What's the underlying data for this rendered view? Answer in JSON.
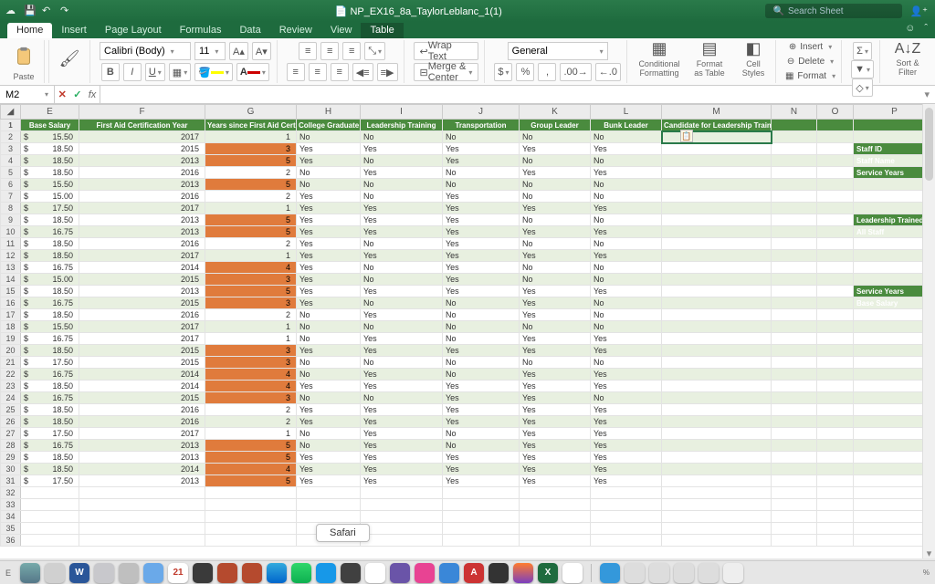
{
  "title": "NP_EX16_8a_TaylorLeblanc_1(1)",
  "search_placeholder": "Search Sheet",
  "tabs": [
    "Home",
    "Insert",
    "Page Layout",
    "Formulas",
    "Data",
    "Review",
    "View",
    "Table"
  ],
  "active_tab": "Home",
  "context_tab": "Table",
  "paste_label": "Paste",
  "font_name": "Calibri (Body)",
  "font_size": "11",
  "wrap_text": "Wrap Text",
  "merge_center": "Merge & Center",
  "number_format": "General",
  "cond_fmt": "Conditional\nFormatting",
  "fmt_table": "Format\nas Table",
  "cell_styles": "Cell\nStyles",
  "insert": "Insert",
  "delete": "Delete",
  "format": "Format",
  "sort_filter": "Sort &\nFilter",
  "name_box": "M2",
  "columns": [
    "E",
    "F",
    "G",
    "H",
    "I",
    "J",
    "K",
    "L",
    "M",
    "N",
    "O",
    "P"
  ],
  "headers": {
    "E": "Base Salary",
    "F": "First Aid Certification Year",
    "G": "Years since First Aid Certification",
    "H": "College Graduate",
    "I": "Leadership Training",
    "J": "Transportation",
    "K": "Group Leader",
    "L": "Bunk Leader",
    "M": "Candidate for Leadership Training"
  },
  "side_labels": {
    "staff_id": "Staff ID",
    "staff_name": "Staff Name",
    "service_years": "Service Years",
    "lts": "Leadership Trained Staff",
    "all_staff": "All Staff",
    "sy2": "Service Years",
    "base_salary": "Base Salary"
  },
  "rows": [
    {
      "r": 2,
      "sal": "15.50",
      "yr": "2017",
      "since": "1",
      "flag": false,
      "cg": "No",
      "lt": "No",
      "tr": "No",
      "gl": "No",
      "bl": "No"
    },
    {
      "r": 3,
      "sal": "18.50",
      "yr": "2015",
      "since": "3",
      "flag": true,
      "cg": "Yes",
      "lt": "Yes",
      "tr": "Yes",
      "gl": "Yes",
      "bl": "Yes"
    },
    {
      "r": 4,
      "sal": "18.50",
      "yr": "2013",
      "since": "5",
      "flag": true,
      "cg": "Yes",
      "lt": "No",
      "tr": "Yes",
      "gl": "No",
      "bl": "No"
    },
    {
      "r": 5,
      "sal": "18.50",
      "yr": "2016",
      "since": "2",
      "flag": false,
      "cg": "No",
      "lt": "Yes",
      "tr": "No",
      "gl": "Yes",
      "bl": "Yes"
    },
    {
      "r": 6,
      "sal": "15.50",
      "yr": "2013",
      "since": "5",
      "flag": true,
      "cg": "No",
      "lt": "No",
      "tr": "No",
      "gl": "No",
      "bl": "No"
    },
    {
      "r": 7,
      "sal": "15.00",
      "yr": "2016",
      "since": "2",
      "flag": false,
      "cg": "Yes",
      "lt": "No",
      "tr": "Yes",
      "gl": "No",
      "bl": "No"
    },
    {
      "r": 8,
      "sal": "17.50",
      "yr": "2017",
      "since": "1",
      "flag": false,
      "cg": "Yes",
      "lt": "Yes",
      "tr": "Yes",
      "gl": "Yes",
      "bl": "Yes"
    },
    {
      "r": 9,
      "sal": "18.50",
      "yr": "2013",
      "since": "5",
      "flag": true,
      "cg": "Yes",
      "lt": "Yes",
      "tr": "Yes",
      "gl": "No",
      "bl": "No"
    },
    {
      "r": 10,
      "sal": "16.75",
      "yr": "2013",
      "since": "5",
      "flag": true,
      "cg": "Yes",
      "lt": "Yes",
      "tr": "Yes",
      "gl": "Yes",
      "bl": "Yes"
    },
    {
      "r": 11,
      "sal": "18.50",
      "yr": "2016",
      "since": "2",
      "flag": false,
      "cg": "Yes",
      "lt": "No",
      "tr": "Yes",
      "gl": "No",
      "bl": "No"
    },
    {
      "r": 12,
      "sal": "18.50",
      "yr": "2017",
      "since": "1",
      "flag": false,
      "cg": "Yes",
      "lt": "Yes",
      "tr": "Yes",
      "gl": "Yes",
      "bl": "Yes"
    },
    {
      "r": 13,
      "sal": "16.75",
      "yr": "2014",
      "since": "4",
      "flag": true,
      "cg": "Yes",
      "lt": "No",
      "tr": "Yes",
      "gl": "No",
      "bl": "No"
    },
    {
      "r": 14,
      "sal": "15.00",
      "yr": "2015",
      "since": "3",
      "flag": true,
      "cg": "Yes",
      "lt": "No",
      "tr": "Yes",
      "gl": "No",
      "bl": "No"
    },
    {
      "r": 15,
      "sal": "18.50",
      "yr": "2013",
      "since": "5",
      "flag": true,
      "cg": "Yes",
      "lt": "Yes",
      "tr": "Yes",
      "gl": "Yes",
      "bl": "Yes"
    },
    {
      "r": 16,
      "sal": "16.75",
      "yr": "2015",
      "since": "3",
      "flag": true,
      "cg": "Yes",
      "lt": "No",
      "tr": "No",
      "gl": "Yes",
      "bl": "No"
    },
    {
      "r": 17,
      "sal": "18.50",
      "yr": "2016",
      "since": "2",
      "flag": false,
      "cg": "No",
      "lt": "Yes",
      "tr": "No",
      "gl": "Yes",
      "bl": "No"
    },
    {
      "r": 18,
      "sal": "15.50",
      "yr": "2017",
      "since": "1",
      "flag": false,
      "cg": "No",
      "lt": "No",
      "tr": "No",
      "gl": "No",
      "bl": "No"
    },
    {
      "r": 19,
      "sal": "16.75",
      "yr": "2017",
      "since": "1",
      "flag": false,
      "cg": "No",
      "lt": "Yes",
      "tr": "No",
      "gl": "Yes",
      "bl": "Yes"
    },
    {
      "r": 20,
      "sal": "18.50",
      "yr": "2015",
      "since": "3",
      "flag": true,
      "cg": "Yes",
      "lt": "Yes",
      "tr": "Yes",
      "gl": "Yes",
      "bl": "Yes"
    },
    {
      "r": 21,
      "sal": "17.50",
      "yr": "2015",
      "since": "3",
      "flag": true,
      "cg": "No",
      "lt": "No",
      "tr": "No",
      "gl": "No",
      "bl": "No"
    },
    {
      "r": 22,
      "sal": "16.75",
      "yr": "2014",
      "since": "4",
      "flag": true,
      "cg": "No",
      "lt": "Yes",
      "tr": "No",
      "gl": "Yes",
      "bl": "Yes"
    },
    {
      "r": 23,
      "sal": "18.50",
      "yr": "2014",
      "since": "4",
      "flag": true,
      "cg": "Yes",
      "lt": "Yes",
      "tr": "Yes",
      "gl": "Yes",
      "bl": "Yes"
    },
    {
      "r": 24,
      "sal": "16.75",
      "yr": "2015",
      "since": "3",
      "flag": true,
      "cg": "No",
      "lt": "No",
      "tr": "Yes",
      "gl": "Yes",
      "bl": "No"
    },
    {
      "r": 25,
      "sal": "18.50",
      "yr": "2016",
      "since": "2",
      "flag": false,
      "cg": "Yes",
      "lt": "Yes",
      "tr": "Yes",
      "gl": "Yes",
      "bl": "Yes"
    },
    {
      "r": 26,
      "sal": "18.50",
      "yr": "2016",
      "since": "2",
      "flag": false,
      "cg": "Yes",
      "lt": "Yes",
      "tr": "Yes",
      "gl": "Yes",
      "bl": "Yes"
    },
    {
      "r": 27,
      "sal": "17.50",
      "yr": "2017",
      "since": "1",
      "flag": false,
      "cg": "No",
      "lt": "Yes",
      "tr": "No",
      "gl": "Yes",
      "bl": "Yes"
    },
    {
      "r": 28,
      "sal": "16.75",
      "yr": "2013",
      "since": "5",
      "flag": true,
      "cg": "No",
      "lt": "Yes",
      "tr": "No",
      "gl": "Yes",
      "bl": "Yes"
    },
    {
      "r": 29,
      "sal": "18.50",
      "yr": "2013",
      "since": "5",
      "flag": true,
      "cg": "Yes",
      "lt": "Yes",
      "tr": "Yes",
      "gl": "Yes",
      "bl": "Yes"
    },
    {
      "r": 30,
      "sal": "18.50",
      "yr": "2014",
      "since": "4",
      "flag": true,
      "cg": "Yes",
      "lt": "Yes",
      "tr": "Yes",
      "gl": "Yes",
      "bl": "Yes"
    },
    {
      "r": 31,
      "sal": "17.50",
      "yr": "2013",
      "since": "5",
      "flag": true,
      "cg": "Yes",
      "lt": "Yes",
      "tr": "Yes",
      "gl": "Yes",
      "bl": "Yes"
    }
  ],
  "safari_tooltip": "Safari",
  "dock": [
    {
      "bg": "linear-gradient(#7aa,#578)",
      "t": ""
    },
    {
      "bg": "#d0d0d0",
      "t": ""
    },
    {
      "bg": "#2a5699",
      "t": "W"
    },
    {
      "bg": "#c8c8cc",
      "t": ""
    },
    {
      "bg": "#bfbfbf",
      "t": ""
    },
    {
      "bg": "#6aa9e9",
      "t": ""
    },
    {
      "bg": "#fff",
      "t": "21",
      "c": "#c0392b"
    },
    {
      "bg": "#3a3a3a",
      "t": ""
    },
    {
      "bg": "#b54a2e",
      "t": ""
    },
    {
      "bg": "#b54a2e",
      "t": ""
    },
    {
      "bg": "linear-gradient(#3ad,#06c)",
      "t": ""
    },
    {
      "bg": "linear-gradient(#2fd76b,#0eb050)",
      "t": ""
    },
    {
      "bg": "#1798e8",
      "t": ""
    },
    {
      "bg": "#404040",
      "t": ""
    },
    {
      "bg": "#fff",
      "t": ""
    },
    {
      "bg": "#6a54a8",
      "t": ""
    },
    {
      "bg": "#e84393",
      "t": ""
    },
    {
      "bg": "#3a87d8",
      "t": ""
    },
    {
      "bg": "#c33",
      "t": "A"
    },
    {
      "bg": "#333",
      "t": ""
    },
    {
      "bg": "linear-gradient(#ff7b2e,#7b3fbf)",
      "t": ""
    },
    {
      "bg": "#1e6b3e",
      "t": "X"
    },
    {
      "bg": "#fff",
      "t": ""
    }
  ],
  "dock_right": [
    {
      "bg": "#3498db",
      "t": ""
    },
    {
      "bg": "#ddd",
      "t": ""
    },
    {
      "bg": "#ddd",
      "t": ""
    },
    {
      "bg": "#ddd",
      "t": ""
    },
    {
      "bg": "#ddd",
      "t": ""
    },
    {
      "bg": "#eee",
      "t": ""
    }
  ]
}
